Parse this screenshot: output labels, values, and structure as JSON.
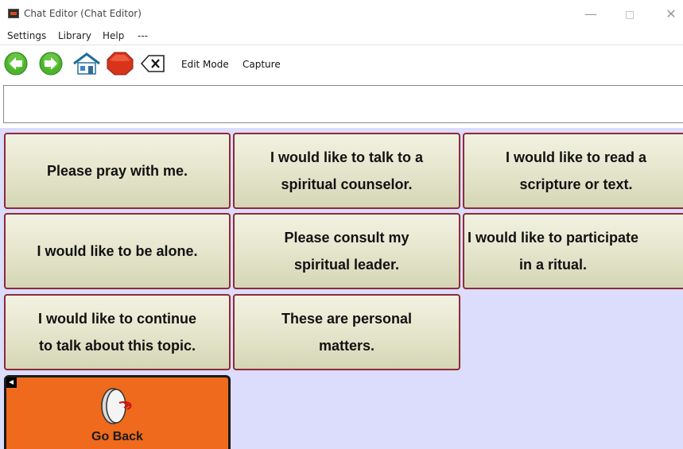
{
  "window": {
    "title": "Chat Editor (Chat Editor)",
    "minimize": "—",
    "close": "✕"
  },
  "menu": {
    "items": [
      "Settings",
      "Library",
      "Help",
      "---"
    ]
  },
  "toolbar": {
    "icons": [
      "back-arrow-icon",
      "forward-arrow-icon",
      "home-icon",
      "stop-icon",
      "clear-icon"
    ],
    "edit_mode": "Edit Mode",
    "capture": "Capture"
  },
  "message_bar": {
    "value": ""
  },
  "phrases": {
    "r1c1": [
      "Please pray with me."
    ],
    "r1c2": [
      "I would like to talk to a",
      "spiritual counselor."
    ],
    "r1c3": [
      "I would like to read a",
      "scripture or text."
    ],
    "r2c1": [
      "I would like to be alone."
    ],
    "r2c2": [
      "Please consult my",
      "spiritual leader."
    ],
    "r2c3": [
      "I would like to participate",
      "in a ritual."
    ],
    "r3c1": [
      "I would like to continue",
      "to talk about this topic."
    ],
    "r3c2": [
      "These are personal",
      "matters."
    ]
  },
  "go_back": {
    "label": "Go Back"
  },
  "colors": {
    "grid_background": "#dcdcfc",
    "cell_border": "#8d2b38",
    "go_back_background": "#ef6a1c"
  }
}
